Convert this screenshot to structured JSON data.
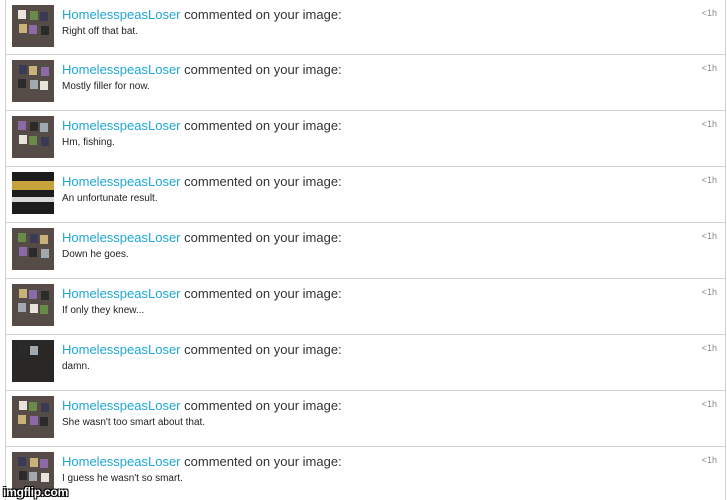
{
  "notifications": [
    {
      "user": "HomelesspeasLoser",
      "action": "commented on your image:",
      "comment": "Right off that bat.",
      "time": "<1h",
      "thumb": "collage"
    },
    {
      "user": "HomelesspeasLoser",
      "action": "commented on your image:",
      "comment": "Mostly filler for now.",
      "time": "<1h",
      "thumb": "collage"
    },
    {
      "user": "HomelesspeasLoser",
      "action": "commented on your image:",
      "comment": "Hm, fishing.",
      "time": "<1h",
      "thumb": "collage"
    },
    {
      "user": "HomelesspeasLoser",
      "action": "commented on your image:",
      "comment": "An unfortunate result.",
      "time": "<1h",
      "thumb": "banner"
    },
    {
      "user": "HomelesspeasLoser",
      "action": "commented on your image:",
      "comment": "Down he goes.",
      "time": "<1h",
      "thumb": "collage"
    },
    {
      "user": "HomelesspeasLoser",
      "action": "commented on your image:",
      "comment": "If only they knew...",
      "time": "<1h",
      "thumb": "collage"
    },
    {
      "user": "HomelesspeasLoser",
      "action": "commented on your image:",
      "comment": "damn.",
      "time": "<1h",
      "thumb": "dark"
    },
    {
      "user": "HomelesspeasLoser",
      "action": "commented on your image:",
      "comment": "She wasn't too smart about that.",
      "time": "<1h",
      "thumb": "collage"
    },
    {
      "user": "HomelesspeasLoser",
      "action": "commented on your image:",
      "comment": "I guess he wasn't so smart.",
      "time": "<1h",
      "thumb": "collage"
    }
  ],
  "watermark": "imgflip.com",
  "colors": {
    "username": "#1fa6d6",
    "thumb_bg": "#554c48",
    "divider": "#d0d0d0"
  }
}
